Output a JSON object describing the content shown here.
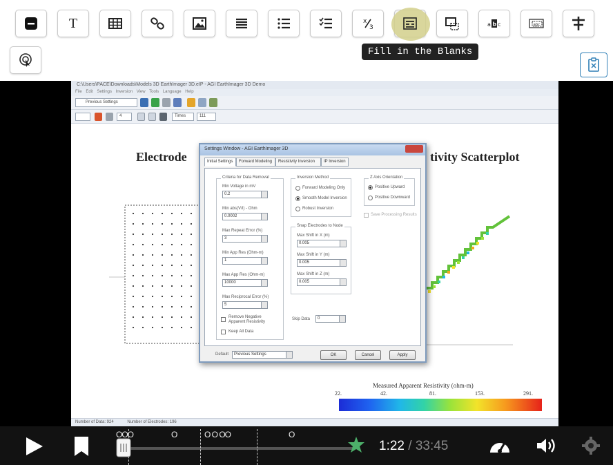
{
  "toolbar": {
    "row1": [
      {
        "icon": "blank-icon"
      },
      {
        "icon": "text-icon",
        "label": "T"
      },
      {
        "icon": "table-icon"
      },
      {
        "icon": "link-icon"
      },
      {
        "icon": "image-icon"
      },
      {
        "icon": "list-icon"
      },
      {
        "icon": "ordered-list-icon"
      },
      {
        "icon": "checklist-icon"
      },
      {
        "icon": "fraction-icon",
        "label": "x/₃"
      },
      {
        "icon": "fill-in-blanks-icon",
        "active": true
      },
      {
        "icon": "drag-box-icon"
      },
      {
        "icon": "mark-words-icon"
      },
      {
        "icon": "drag-text-icon"
      },
      {
        "icon": "split-icon"
      }
    ],
    "row2": [
      {
        "icon": "hotspot-icon"
      }
    ],
    "tooltip": "Fill in the Blanks",
    "clipboard_icon": "paste-icon"
  },
  "screen": {
    "window_title": "C:\\Users\\PACE\\Downloads\\Models 3D EarthImager 3D.eIP - AGI EarthImager 3D Demo",
    "menu": "File   Edit   Settings   Inversion   View   Tools   Language   Help",
    "toolbar_combo": "Previous Settings",
    "toolbar2": {
      "num": "4",
      "time": "Times",
      "size": "111"
    },
    "left_title": "Electrode",
    "right_title": "tivity Scatterplot",
    "status_left": "Number of Data: 924",
    "status_right": "Number of Electrodes: 196",
    "colorbar": {
      "title": "Measured Apparent Resistivity (ohm-m)",
      "ticks": [
        "22.",
        "42.",
        "81.",
        "153.",
        "291."
      ]
    }
  },
  "dialog": {
    "title": "Settings Window - AGI EarthImager 3D",
    "tabs": [
      "Initial Settings",
      "Forward Modeling",
      "Resistivity Inversion",
      "IP Inversion"
    ],
    "data_removal": {
      "label": "Criteria for Data Removal",
      "fields": [
        {
          "label": "Min Voltage in mV",
          "value": "0.2"
        },
        {
          "label": "Min abs(V/I) - Ohm",
          "value": "0.0002"
        },
        {
          "label": "Max Repeat Error (%)",
          "value": "3"
        },
        {
          "label": "Min App Res (Ohm-m)",
          "value": "1"
        },
        {
          "label": "Max App Res (Ohm-m)",
          "value": "10000"
        },
        {
          "label": "Max Reciprocal Error (%)",
          "value": "5"
        }
      ],
      "remove_negative": "Remove Negative Apparent Resistivity",
      "keep_all": "Keep All Data"
    },
    "inversion_method": {
      "label": "Inversion Method",
      "options": [
        "Forward Modeling Only",
        "Smooth Model Inversion",
        "Robust Inversion"
      ],
      "selected": 1
    },
    "snap": {
      "label": "Snap Electrodes to Node",
      "fields": [
        {
          "label": "Max Shift in X (m)",
          "value": "0.005"
        },
        {
          "label": "Max Shift in Y (m)",
          "value": "0.005"
        },
        {
          "label": "Max Shift in Z (m)",
          "value": "0.005"
        }
      ]
    },
    "z_axis": {
      "label": "Z Axis Orientation",
      "options": [
        "Positive Upward",
        "Positive Downward"
      ],
      "selected": 0
    },
    "save_results": "Save Processing Results",
    "skip_data": {
      "label": "Skip Data",
      "value": "0"
    },
    "default_label": "Default",
    "default_value": "Previous Settings",
    "buttons": {
      "ok": "OK",
      "cancel": "Cancel",
      "apply": "Apply"
    }
  },
  "player": {
    "current_time": "1:22",
    "separator": " / ",
    "duration": "33:45",
    "markers": [
      "OOO",
      "O",
      "O O OO",
      "O"
    ],
    "progress_fraction": 0.04
  }
}
